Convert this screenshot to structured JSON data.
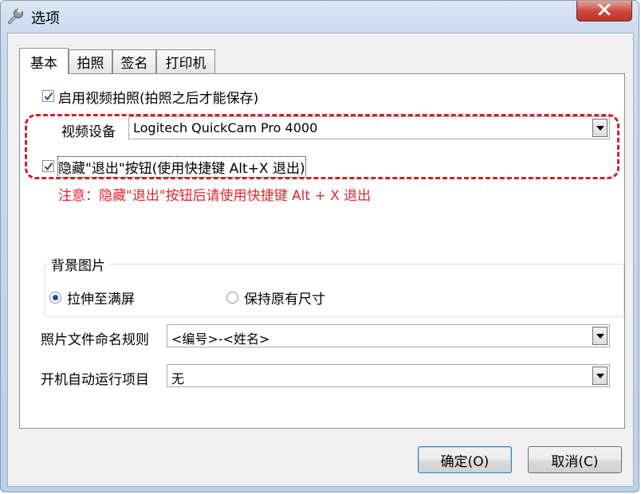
{
  "window": {
    "title": "选项",
    "close_symbol": "✕"
  },
  "tabs": [
    {
      "label": "基本",
      "active": true
    },
    {
      "label": "拍照",
      "active": false
    },
    {
      "label": "签名",
      "active": false
    },
    {
      "label": "打印机",
      "active": false
    }
  ],
  "basic": {
    "enable_video_capture": {
      "label": "启用视频拍照(拍照之后才能保存)",
      "checked": true
    },
    "video_device": {
      "label": "视频设备",
      "value": "Logitech QuickCam Pro 4000"
    },
    "hide_exit_button": {
      "label": "隐藏\"退出\"按钮(使用快捷键 Alt+X 退出)",
      "checked": true
    },
    "note": "注意：隐藏\"退出\"按钮后请使用快捷键 Alt + X 退出",
    "background": {
      "legend": "背景图片",
      "options": [
        {
          "label": "拉伸至满屏",
          "selected": true
        },
        {
          "label": "保持原有尺寸",
          "selected": false
        }
      ]
    },
    "photo_naming": {
      "label": "照片文件命名规则",
      "value": "<编号>-<姓名>"
    },
    "startup_item": {
      "label": "开机自动运行项目",
      "value": "无"
    }
  },
  "buttons": {
    "ok": "确定(O)",
    "cancel": "取消(C)"
  },
  "colors": {
    "accent_red": "#d2202a",
    "warning_text": "#e0262e"
  },
  "icons": {
    "title": "wrench-icon",
    "close": "close-icon"
  }
}
